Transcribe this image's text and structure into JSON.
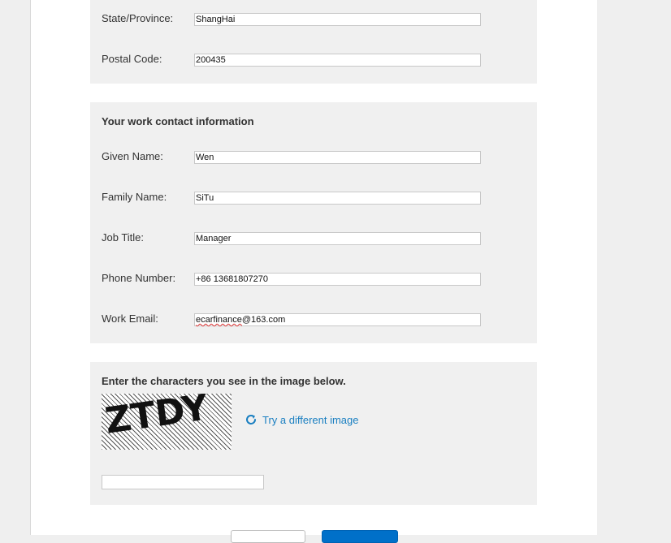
{
  "address": {
    "state_label": "State/Province:",
    "state_value": "ShangHai",
    "postal_label": "Postal Code:",
    "postal_value": "200435"
  },
  "contact": {
    "title": "Your work contact information",
    "given_label": "Given Name:",
    "given_value": "Wen",
    "family_label": "Family Name:",
    "family_value": "SiTu",
    "job_label": "Job Title:",
    "job_value": "Manager",
    "phone_label": "Phone Number:",
    "phone_value": "+86 13681807270",
    "email_label": "Work Email:",
    "email_value_user": "ecarfinance",
    "email_value_domain": "@163.com"
  },
  "captcha": {
    "title": "Enter the characters you see in the image below.",
    "image_text": "ZTDY",
    "refresh_label": "Try a different image",
    "input_value": ""
  },
  "colors": {
    "link": "#1a7fc1",
    "primary_button": "#0070c9",
    "section_bg": "#f0f0f0"
  }
}
